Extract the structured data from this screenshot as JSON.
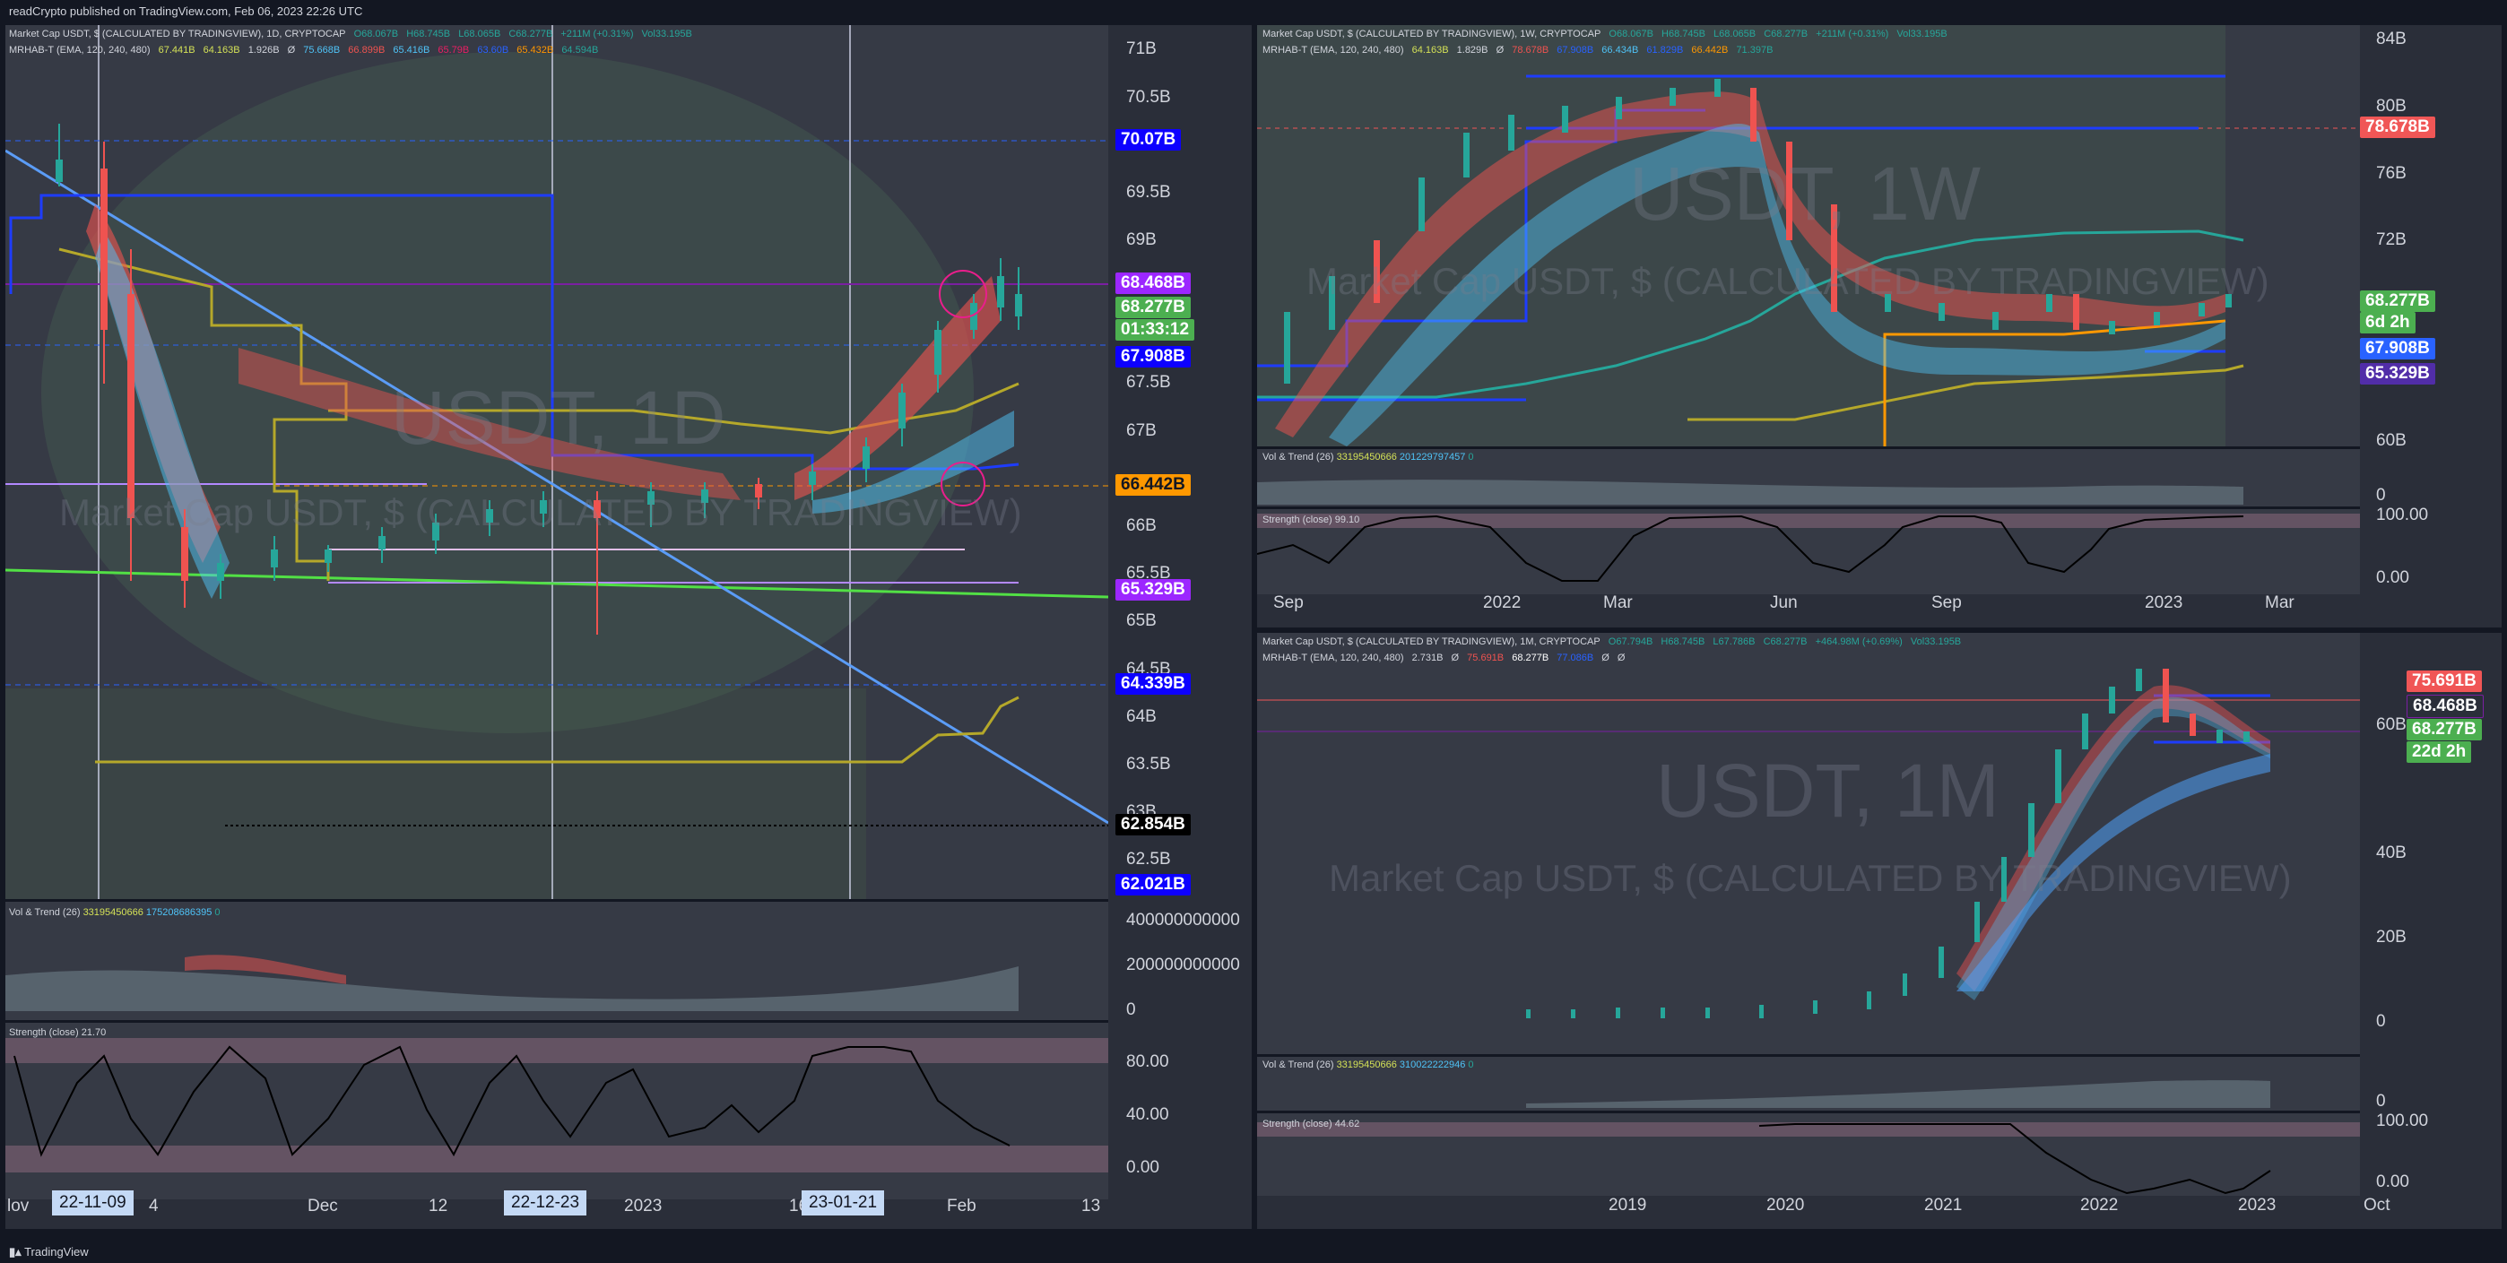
{
  "header": {
    "text": "readCrypto published on TradingView.com, Feb 06, 2023 22:26 UTC"
  },
  "footer": {
    "logo_text": "TradingView"
  },
  "daily": {
    "legend1": "Market Cap USDT, $ (CALCULATED BY TRADINGVIEW), 1D, CRYPTOCAP",
    "ohlc": [
      "O68.067B",
      "H68.745B",
      "L68.065B",
      "C68.277B",
      "+211M (+0.31%)",
      "Vol33.195B"
    ],
    "legend2": "MRHAB-T (EMA, 120, 240, 480)",
    "ind": [
      "67.441B",
      "64.163B",
      "1.926B",
      "Ø",
      "75.668B",
      "66.899B",
      "65.416B",
      "65.79B",
      "63.60B",
      "65.432B",
      "64.594B"
    ],
    "watermark1": "USDT, 1D",
    "watermark2": "Market Cap USDT, $ (CALCULATED BY TRADINGVIEW)",
    "yaxis": [
      "71B",
      "70.5B",
      "69.5B",
      "69B",
      "67.5B",
      "67B",
      "66B",
      "65.5B",
      "65B",
      "64.5B",
      "64B",
      "63.5B",
      "63B",
      "62.5B"
    ],
    "tags": [
      "70.07B",
      "68.468B",
      "68.277B",
      "01:33:12",
      "67.908B",
      "66.442B",
      "65.329B",
      "64.339B",
      "62.854B",
      "62.021B"
    ],
    "vol_label": "Vol & Trend (26)",
    "vol_vals": [
      "33195450666",
      "175208686395",
      "0"
    ],
    "vol_axis": [
      "400000000000",
      "200000000000",
      "0"
    ],
    "str_label": "Strength (close)",
    "str_val": "21.70",
    "str_axis": [
      "80.00",
      "40.00",
      "0.00"
    ],
    "xaxis": [
      "lov",
      "4",
      "Dec",
      "12",
      "2023",
      "16",
      "Feb",
      "13"
    ],
    "xbadges": [
      "22-11-09",
      "22-12-23",
      "23-01-21"
    ]
  },
  "weekly": {
    "legend1": "Market Cap USDT, $ (CALCULATED BY TRADINGVIEW), 1W, CRYPTOCAP",
    "ohlc": [
      "O68.067B",
      "H68.745B",
      "L68.065B",
      "C68.277B",
      "+211M (+0.31%)",
      "Vol33.195B"
    ],
    "legend2": "MRHAB-T (EMA, 120, 240, 480)",
    "ind": [
      "64.163B",
      "1.829B",
      "Ø",
      "78.678B",
      "67.908B",
      "66.434B",
      "61.829B",
      "66.442B",
      "71.397B"
    ],
    "watermark1": "USDT, 1W",
    "watermark2": "Market Cap USDT, $ (CALCULATED BY TRADINGVIEW)",
    "yaxis": [
      "84B",
      "80B",
      "76B",
      "72B",
      "60B"
    ],
    "tags": [
      "78.678B",
      "68.277B",
      "6d 2h",
      "67.908B",
      "65.329B"
    ],
    "vol_label": "Vol & Trend (26)",
    "vol_vals": [
      "33195450666",
      "201229797457",
      "0"
    ],
    "vol_axis": [
      "0"
    ],
    "str_label": "Strength (close)",
    "str_val": "99.10",
    "str_axis": [
      "100.00",
      "0.00"
    ],
    "xaxis": [
      "Sep",
      "2022",
      "Mar",
      "Jun",
      "Sep",
      "2023",
      "Mar"
    ]
  },
  "monthly": {
    "legend1": "Market Cap USDT, $ (CALCULATED BY TRADINGVIEW), 1M, CRYPTOCAP",
    "ohlc": [
      "O67.794B",
      "H68.745B",
      "L67.786B",
      "C68.277B",
      "+464.98M (+0.69%)",
      "Vol33.195B"
    ],
    "legend2": "MRHAB-T (EMA, 120, 240, 480)",
    "ind": [
      "2.731B",
      "Ø",
      "75.691B",
      "68.277B",
      "77.086B",
      "Ø",
      "Ø"
    ],
    "watermark1": "USDT, 1M",
    "watermark2": "Market Cap USDT, $ (CALCULATED BY TRADINGVIEW)",
    "yaxis": [
      "60B",
      "40B",
      "20B",
      "0"
    ],
    "tags": [
      "75.691B",
      "68.468B",
      "68.277B",
      "22d 2h"
    ],
    "vol_label": "Vol & Trend (26)",
    "vol_vals": [
      "33195450666",
      "310022222946",
      "0"
    ],
    "vol_axis": [
      "0"
    ],
    "str_label": "Strength (close)",
    "str_val": "44.62",
    "str_axis": [
      "100.00",
      "0.00"
    ],
    "xaxis": [
      "2019",
      "2020",
      "2021",
      "2022",
      "2023",
      "Oct"
    ]
  },
  "colors": {
    "bg": "#131722",
    "panel": "#2a2e39",
    "up": "#26a69a",
    "down": "#ef5350",
    "blue_tag": "#0d00ff",
    "purple_tag": "#9c27ff",
    "green_tag": "#4caf50",
    "orange_tag": "#ff9800",
    "red_tag": "#f05656"
  }
}
